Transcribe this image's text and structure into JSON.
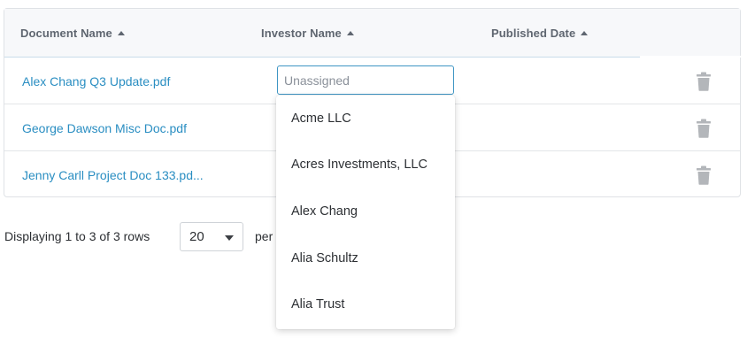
{
  "table": {
    "headers": {
      "document_name": "Document Name",
      "investor_name": "Investor Name",
      "published_date": "Published Date"
    },
    "rows": [
      {
        "document": "Alex Chang Q3 Update.pdf"
      },
      {
        "document": "George Dawson Misc Doc.pdf"
      },
      {
        "document": "Jenny Carll Project Doc 133.pd..."
      }
    ]
  },
  "investor_select": {
    "placeholder": "Unassigned",
    "value": "",
    "options": [
      "Acme LLC",
      "Acres Investments, LLC",
      "Alex Chang",
      "Alia Schultz",
      "Alia Trust"
    ]
  },
  "footer": {
    "display_text": "Displaying 1 to 3 of 3 rows",
    "page_size": "20",
    "per_label": "per"
  },
  "icons": {
    "sort": "sort-ascending-icon",
    "delete": "trash-icon",
    "dropdown": "chevron-down-icon"
  },
  "colors": {
    "link": "#2a8ec2",
    "focus_border": "#3f96c4",
    "trash": "#b3b6ba"
  }
}
